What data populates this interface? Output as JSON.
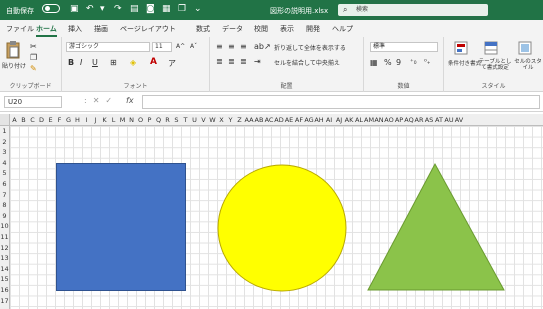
{
  "titlebar": {
    "autosave": "自動保存",
    "filename": "図形の説明用.xlsx",
    "search_placeholder": "検索"
  },
  "tabs": [
    "ファイル",
    "ホーム",
    "挿入",
    "描画",
    "ページレイアウト",
    "数式",
    "データ",
    "校閲",
    "表示",
    "開発",
    "ヘルプ"
  ],
  "active_tab": "ホーム",
  "ribbon": {
    "clipboard": {
      "label": "クリップボード",
      "paste": "貼り付け"
    },
    "font": {
      "label": "フォント",
      "name": "游ゴシック",
      "size": "11",
      "grow": "A^",
      "shrink": "Aˇ",
      "bold": "B",
      "italic": "I",
      "underline": "U"
    },
    "alignment": {
      "label": "配置",
      "wrap": "折り返して全体を表示する",
      "merge": "セルを結合して中央揃え"
    },
    "number": {
      "label": "数値",
      "format": "標準",
      "pct": "%",
      "comma": "9"
    },
    "styles": {
      "label": "スタイル",
      "cond": "条件付き書式",
      "table": "テーブルとして書式設定",
      "cell": "セルのスタイル"
    }
  },
  "formula_bar": {
    "namebox": "U20",
    "formula": ""
  },
  "columns": [
    "A",
    "B",
    "C",
    "D",
    "E",
    "F",
    "G",
    "H",
    "I",
    "J",
    "K",
    "L",
    "M",
    "N",
    "O",
    "P",
    "Q",
    "R",
    "S",
    "T",
    "U",
    "V",
    "W",
    "X",
    "Y",
    "Z",
    "AA",
    "AB",
    "AC",
    "AD",
    "AE",
    "AF",
    "AG",
    "AH",
    "AI",
    "AJ",
    "AK",
    "AL",
    "AM",
    "AN",
    "AO",
    "AP",
    "AQ",
    "AR",
    "AS",
    "AT",
    "AU",
    "AV"
  ],
  "rows": [
    "1",
    "2",
    "3",
    "4",
    "5",
    "6",
    "7",
    "8",
    "9",
    "10",
    "11",
    "12",
    "13",
    "14",
    "15",
    "16",
    "17"
  ],
  "shapes": {
    "rectangle_color": "#4472c4",
    "circle_color": "#ffff00",
    "triangle_color": "#8bc34a"
  },
  "colors": {
    "accent": "#217346"
  }
}
